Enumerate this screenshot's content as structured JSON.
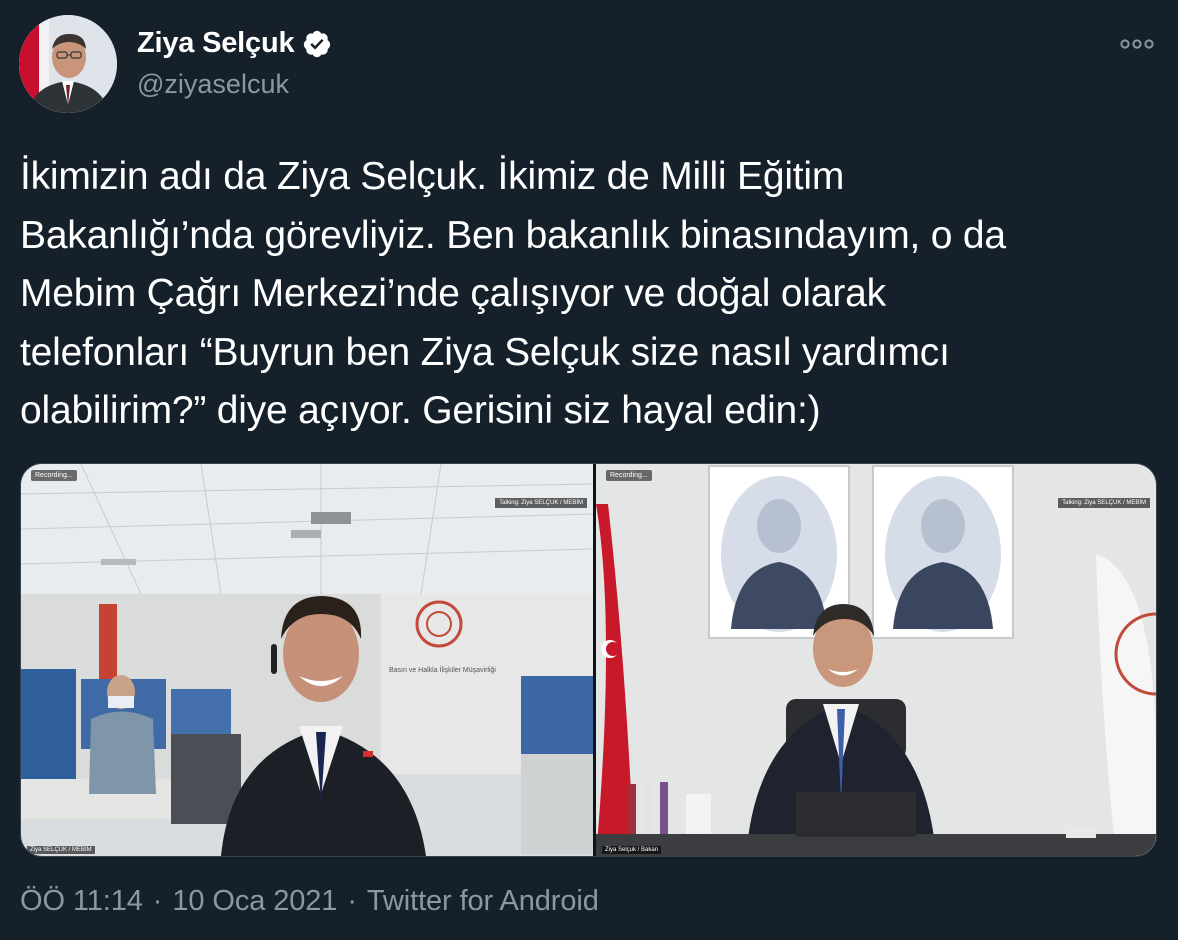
{
  "user": {
    "display_name": "Ziya Selçuk",
    "handle": "@ziyaselcuk",
    "verified": true
  },
  "tweet": {
    "text": "İkimizin adı da Ziya Selçuk. İkimiz de Milli Eğitim\nBakanlığı’nda görevliyiz. Ben bakanlık binasındayım, o da\nMebim Çağrı Merkezi’nde çalışıyor ve doğal olarak\ntelefonları “Buyrun ben Ziya Selçuk size nasıl yardımcı\nolabilirim?” diye açıyor. Gerisini siz hayal edin:)"
  },
  "media": {
    "left": {
      "recording_label": "Recording...",
      "talking_label": "Talking: Ziya SELÇUK / MEBİM",
      "name_tag": "Ziya SELÇUK / MEBİM",
      "sign_text": "Basın ve Halkla İlişkiler Müşavirliği"
    },
    "right": {
      "recording_label": "Recording...",
      "talking_label": "Talking: Ziya SELÇUK / MEBİM",
      "name_tag": "Ziya Selçuk / Bakan"
    }
  },
  "footer": {
    "time": "ÖÖ 11:14",
    "separator": "·",
    "date": "10 Oca 2021",
    "source": "Twitter for Android"
  },
  "icons": {
    "verified": "verified-badge-icon",
    "more": "more-options-icon"
  },
  "colors": {
    "background": "#15202b",
    "secondary_text": "#8899a6",
    "border": "#38444d"
  }
}
